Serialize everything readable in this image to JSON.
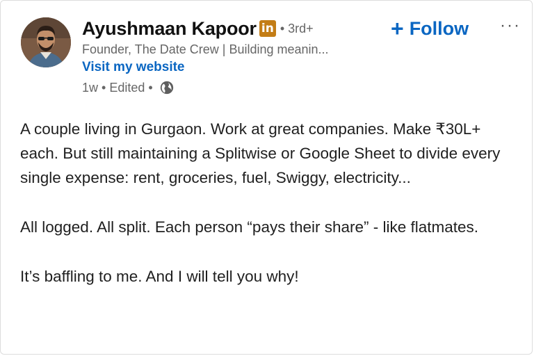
{
  "author": {
    "name": "Ayushmaan Kapoor",
    "badge_text": "in",
    "degree": "• 3rd+",
    "headline": "Founder, The Date Crew | Building meanin...",
    "website_label": "Visit my website",
    "time": "1w",
    "edited": "Edited",
    "visibility_icon": "globe-icon"
  },
  "actions": {
    "follow_plus": "+",
    "follow_label": "Follow",
    "more_label": "···"
  },
  "post": {
    "paragraphs": [
      "A couple living in Gurgaon. Work at great companies. Make ₹30L+ each. But still maintaining a Splitwise or Google Sheet to divide every single expense: rent, groceries, fuel, Swiggy, electricity...",
      "All logged. All split. Each person “pays their share” - like flatmates.",
      "It’s baffling to me. And I will tell you why!"
    ]
  },
  "colors": {
    "link": "#0a66c2",
    "badge": "#c37d16",
    "muted": "#666666"
  }
}
